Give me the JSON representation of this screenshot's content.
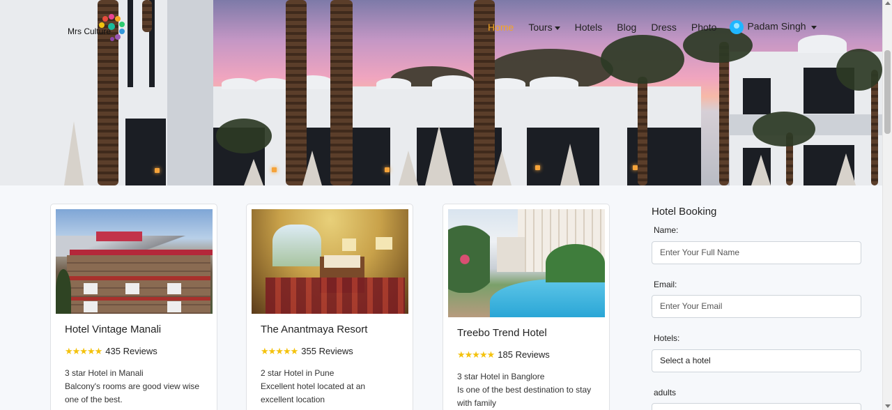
{
  "brand": {
    "name": "Mrs Culture"
  },
  "nav": {
    "items": [
      {
        "label": "Home",
        "active": true,
        "dropdown": false
      },
      {
        "label": "Tours",
        "active": false,
        "dropdown": true
      },
      {
        "label": "Hotels",
        "active": false,
        "dropdown": false
      },
      {
        "label": "Blog",
        "active": false,
        "dropdown": false
      },
      {
        "label": "Dress",
        "active": false,
        "dropdown": false
      },
      {
        "label": "Photo",
        "active": false,
        "dropdown": false
      }
    ],
    "user": {
      "name": "Padam Singh",
      "dropdown": true
    },
    "active_color": "#f5a623"
  },
  "hotels": [
    {
      "title": "Hotel Vintage Manali",
      "stars": "★★★★★",
      "reviews": "435 Reviews",
      "category": "3 star Hotel in Manali",
      "description": "Balcony's rooms are good view wise one of the best."
    },
    {
      "title": "The Anantmaya Resort",
      "stars": "★★★★★",
      "reviews": "355 Reviews",
      "category": "2 star Hotel in Pune",
      "description": "Excellent hotel located at an excellent location"
    },
    {
      "title": "Treebo Trend Hotel",
      "stars": "★★★★★",
      "reviews": "185 Reviews",
      "category": "3 star Hotel in Banglore",
      "description": "Is one of the best destination to stay with family"
    }
  ],
  "booking": {
    "title": "Hotel Booking",
    "name_label": "Name:",
    "name_placeholder": "Enter Your Full Name",
    "email_label": "Email:",
    "email_placeholder": "Enter Your  Email",
    "hotels_label": "Hotels:",
    "hotels_selected": "Select a hotel",
    "adults_label": "adults"
  },
  "colors": {
    "star": "#f4c20d",
    "user_avatar": "#1fb6ff"
  }
}
